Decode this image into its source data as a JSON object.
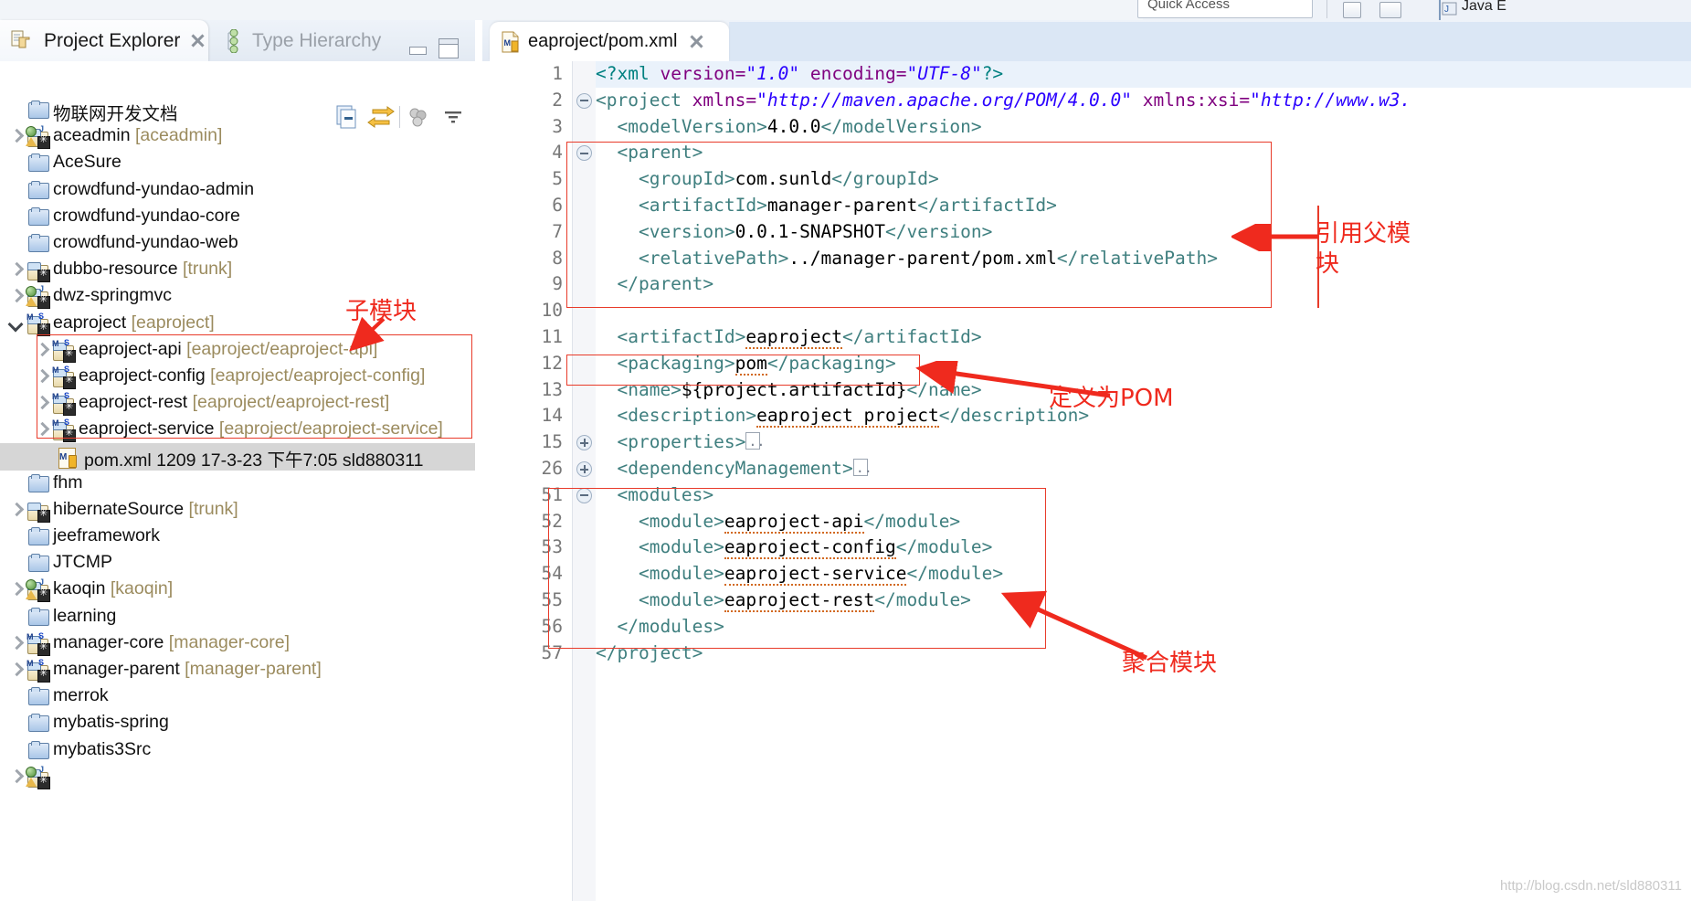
{
  "window": {
    "quick_access_placeholder": "Quick Access",
    "perspective_label": "Java E",
    "watermark": "http://blog.csdn.net/sld880311"
  },
  "left_view": {
    "tabs": [
      {
        "label": "Project Explorer",
        "icon": "project-explorer-icon",
        "active": true,
        "closable": true
      },
      {
        "label": "Type Hierarchy",
        "icon": "type-hierarchy-icon",
        "active": false,
        "closable": false
      }
    ],
    "toolbar": [
      {
        "name": "collapse-all-icon"
      },
      {
        "name": "link-with-editor-icon"
      },
      {
        "name": "focus-on-active-task-icon"
      },
      {
        "name": "view-menu-icon"
      }
    ],
    "tree": [
      {
        "label": "物联网开发文档",
        "sub": "",
        "icon": "folder-icon",
        "arrow": "none",
        "indent": 0,
        "selected": false
      },
      {
        "label": "aceadmin",
        "sub": "[aceadmin]",
        "icon": "web-project-icon",
        "arrow": "right",
        "indent": 0,
        "selected": false
      },
      {
        "label": "AceSure",
        "sub": "",
        "icon": "folder-icon",
        "arrow": "none",
        "indent": 0,
        "selected": false
      },
      {
        "label": "crowdfund-yundao-admin",
        "sub": "",
        "icon": "folder-icon",
        "arrow": "none",
        "indent": 0,
        "selected": false
      },
      {
        "label": "crowdfund-yundao-core",
        "sub": "",
        "icon": "folder-icon",
        "arrow": "none",
        "indent": 0,
        "selected": false
      },
      {
        "label": "crowdfund-yundao-web",
        "sub": "",
        "icon": "folder-icon",
        "arrow": "none",
        "indent": 0,
        "selected": false
      },
      {
        "label": "dubbo-resource",
        "sub": "[trunk]",
        "icon": "svn-project-icon",
        "arrow": "right",
        "indent": 0,
        "selected": false
      },
      {
        "label": "dwz-springmvc",
        "sub": "",
        "icon": "web-project-icon",
        "arrow": "right",
        "indent": 0,
        "selected": false
      },
      {
        "label": "eaproject",
        "sub": "[eaproject]",
        "icon": "maven-project-icon",
        "arrow": "down",
        "indent": 0,
        "selected": false
      },
      {
        "label": "eaproject-api",
        "sub": "[eaproject/eaproject-api]",
        "icon": "maven-project-icon",
        "arrow": "right",
        "indent": 1,
        "selected": false
      },
      {
        "label": "eaproject-config",
        "sub": "[eaproject/eaproject-config]",
        "icon": "maven-project-icon",
        "arrow": "right",
        "indent": 1,
        "selected": false
      },
      {
        "label": "eaproject-rest",
        "sub": "[eaproject/eaproject-rest]",
        "icon": "maven-project-icon",
        "arrow": "right",
        "indent": 1,
        "selected": false
      },
      {
        "label": "eaproject-service",
        "sub": "[eaproject/eaproject-service]",
        "icon": "maven-project-icon",
        "arrow": "right",
        "indent": 1,
        "selected": false
      },
      {
        "label": "pom.xml  1209  17-3-23 下午7:05  sld880311",
        "sub": "",
        "icon": "pom-file-icon",
        "arrow": "none",
        "indent": 2,
        "selected": true
      },
      {
        "label": "fhm",
        "sub": "",
        "icon": "folder-icon",
        "arrow": "none",
        "indent": 0,
        "selected": false
      },
      {
        "label": "hibernateSource",
        "sub": "[trunk]",
        "icon": "svn-project-icon",
        "arrow": "right",
        "indent": 0,
        "selected": false
      },
      {
        "label": "jeeframework",
        "sub": "",
        "icon": "folder-icon",
        "arrow": "none",
        "indent": 0,
        "selected": false
      },
      {
        "label": "JTCMP",
        "sub": "",
        "icon": "folder-icon",
        "arrow": "none",
        "indent": 0,
        "selected": false
      },
      {
        "label": "kaoqin",
        "sub": "[kaoqin]",
        "icon": "web-project-icon",
        "arrow": "right",
        "indent": 0,
        "selected": false
      },
      {
        "label": "learning",
        "sub": "",
        "icon": "folder-icon",
        "arrow": "none",
        "indent": 0,
        "selected": false
      },
      {
        "label": "manager-core",
        "sub": "[manager-core]",
        "icon": "maven-project-icon",
        "arrow": "right",
        "indent": 0,
        "selected": false
      },
      {
        "label": "manager-parent",
        "sub": "[manager-parent]",
        "icon": "maven-project-icon",
        "arrow": "right",
        "indent": 0,
        "selected": false
      },
      {
        "label": "merrok",
        "sub": "",
        "icon": "folder-icon",
        "arrow": "none",
        "indent": 0,
        "selected": false
      },
      {
        "label": "mybatis-spring",
        "sub": "",
        "icon": "folder-icon",
        "arrow": "none",
        "indent": 0,
        "selected": false
      },
      {
        "label": "mybatis3Src",
        "sub": "",
        "icon": "folder-icon",
        "arrow": "none",
        "indent": 0,
        "selected": false
      },
      {
        "label": "",
        "sub": "",
        "icon": "web-project-icon",
        "arrow": "right",
        "indent": 0,
        "selected": false
      }
    ]
  },
  "editor": {
    "tab": {
      "label": "eaproject/pom.xml",
      "icon": "pom-file-icon",
      "closable": true
    },
    "lines": [
      {
        "num": "1",
        "fold": "none",
        "highlight": true,
        "parts": [
          {
            "t": "<?",
            "c": "pi"
          },
          {
            "t": "xml",
            "c": "pi"
          },
          {
            "t": " version=",
            "c": "at"
          },
          {
            "t": "\"1.0\"",
            "c": "av"
          },
          {
            "t": " encoding=",
            "c": "at"
          },
          {
            "t": "\"UTF-8\"",
            "c": "av"
          },
          {
            "t": "?>",
            "c": "pi"
          }
        ]
      },
      {
        "num": "2",
        "fold": "minus",
        "highlight": false,
        "parts": [
          {
            "t": "<project",
            "c": "tg"
          },
          {
            "t": " xmlns=",
            "c": "at"
          },
          {
            "t": "\"http://maven.apache.org/POM/4.0.0\"",
            "c": "av"
          },
          {
            "t": " xmlns:xsi=",
            "c": "at"
          },
          {
            "t": "\"http://www.w3.",
            "c": "av"
          }
        ]
      },
      {
        "num": "3",
        "fold": "none",
        "highlight": false,
        "parts": [
          {
            "t": "  <modelVersion>",
            "c": "tg"
          },
          {
            "t": "4.0.0",
            "c": "tx"
          },
          {
            "t": "</modelVersion>",
            "c": "tg"
          }
        ]
      },
      {
        "num": "4",
        "fold": "minus",
        "highlight": false,
        "parts": [
          {
            "t": "  <parent>",
            "c": "tg"
          }
        ]
      },
      {
        "num": "5",
        "fold": "none",
        "highlight": false,
        "parts": [
          {
            "t": "    <groupId>",
            "c": "tg"
          },
          {
            "t": "com.sunld",
            "c": "tx"
          },
          {
            "t": "</groupId>",
            "c": "tg"
          }
        ]
      },
      {
        "num": "6",
        "fold": "none",
        "highlight": false,
        "parts": [
          {
            "t": "    <artifactId>",
            "c": "tg"
          },
          {
            "t": "manager-parent",
            "c": "tx"
          },
          {
            "t": "</artifactId>",
            "c": "tg"
          }
        ]
      },
      {
        "num": "7",
        "fold": "none",
        "highlight": false,
        "parts": [
          {
            "t": "    <version>",
            "c": "tg"
          },
          {
            "t": "0.0.1-SNAPSHOT",
            "c": "tx"
          },
          {
            "t": "</version>",
            "c": "tg"
          }
        ]
      },
      {
        "num": "8",
        "fold": "none",
        "highlight": false,
        "parts": [
          {
            "t": "    <relativePath>",
            "c": "tg"
          },
          {
            "t": "../manager-parent/pom.xml",
            "c": "tx"
          },
          {
            "t": "</relativePath>",
            "c": "tg"
          }
        ]
      },
      {
        "num": "9",
        "fold": "none",
        "highlight": false,
        "parts": [
          {
            "t": "  </parent>",
            "c": "tg"
          }
        ]
      },
      {
        "num": "10",
        "fold": "none",
        "highlight": false,
        "parts": []
      },
      {
        "num": "11",
        "fold": "none",
        "highlight": false,
        "parts": [
          {
            "t": "  <artifactId>",
            "c": "tg"
          },
          {
            "t": "eaproject",
            "c": "tx-sq"
          },
          {
            "t": "</artifactId>",
            "c": "tg"
          }
        ]
      },
      {
        "num": "12",
        "fold": "none",
        "highlight": false,
        "parts": [
          {
            "t": "  <packaging>",
            "c": "tg"
          },
          {
            "t": "pom",
            "c": "tx-sq"
          },
          {
            "t": "</packaging>",
            "c": "tg"
          }
        ]
      },
      {
        "num": "13",
        "fold": "none",
        "highlight": false,
        "parts": [
          {
            "t": "  <name>",
            "c": "tg"
          },
          {
            "t": "${project.artifactId}",
            "c": "tx"
          },
          {
            "t": "</name>",
            "c": "tg"
          }
        ]
      },
      {
        "num": "14",
        "fold": "none",
        "highlight": false,
        "parts": [
          {
            "t": "  <description>",
            "c": "tg"
          },
          {
            "t": "eaproject project",
            "c": "tx-sq"
          },
          {
            "t": "</description>",
            "c": "tg"
          }
        ]
      },
      {
        "num": "15",
        "fold": "plus",
        "highlight": false,
        "parts": [
          {
            "t": "  <properties>",
            "c": "tg"
          },
          {
            "t": "[FOLD]",
            "c": "fold"
          }
        ]
      },
      {
        "num": "26",
        "fold": "plus",
        "highlight": false,
        "parts": [
          {
            "t": "  <dependencyManagement>",
            "c": "tg"
          },
          {
            "t": "[FOLD]",
            "c": "fold"
          }
        ]
      },
      {
        "num": "51",
        "fold": "minus",
        "highlight": false,
        "parts": [
          {
            "t": "  <modules>",
            "c": "tg"
          }
        ]
      },
      {
        "num": "52",
        "fold": "none",
        "highlight": false,
        "parts": [
          {
            "t": "    <module>",
            "c": "tg"
          },
          {
            "t": "eaproject-api",
            "c": "tx-sq"
          },
          {
            "t": "</module>",
            "c": "tg"
          }
        ]
      },
      {
        "num": "53",
        "fold": "none",
        "highlight": false,
        "parts": [
          {
            "t": "    <module>",
            "c": "tg"
          },
          {
            "t": "eaproject-config",
            "c": "tx-sq"
          },
          {
            "t": "</module>",
            "c": "tg"
          }
        ]
      },
      {
        "num": "54",
        "fold": "none",
        "highlight": false,
        "parts": [
          {
            "t": "    <module>",
            "c": "tg"
          },
          {
            "t": "eaproject-service",
            "c": "tx-sq"
          },
          {
            "t": "</module>",
            "c": "tg"
          }
        ]
      },
      {
        "num": "55",
        "fold": "none",
        "highlight": false,
        "parts": [
          {
            "t": "    <module>",
            "c": "tg"
          },
          {
            "t": "eaproject-rest",
            "c": "tx-sq"
          },
          {
            "t": "</module>",
            "c": "tg"
          }
        ]
      },
      {
        "num": "56",
        "fold": "none",
        "highlight": false,
        "parts": [
          {
            "t": "  </modules>",
            "c": "tg"
          }
        ]
      },
      {
        "num": "57",
        "fold": "none",
        "highlight": false,
        "parts": [
          {
            "t": "</project>",
            "c": "tg"
          }
        ]
      }
    ]
  },
  "annotations": {
    "color": "#ef2a1e",
    "child_module": "子模块",
    "parent_ref_line1": "引用父模",
    "parent_ref_line2": "块",
    "define_pom": "定义为POM",
    "aggregate_module": "聚合模块"
  }
}
